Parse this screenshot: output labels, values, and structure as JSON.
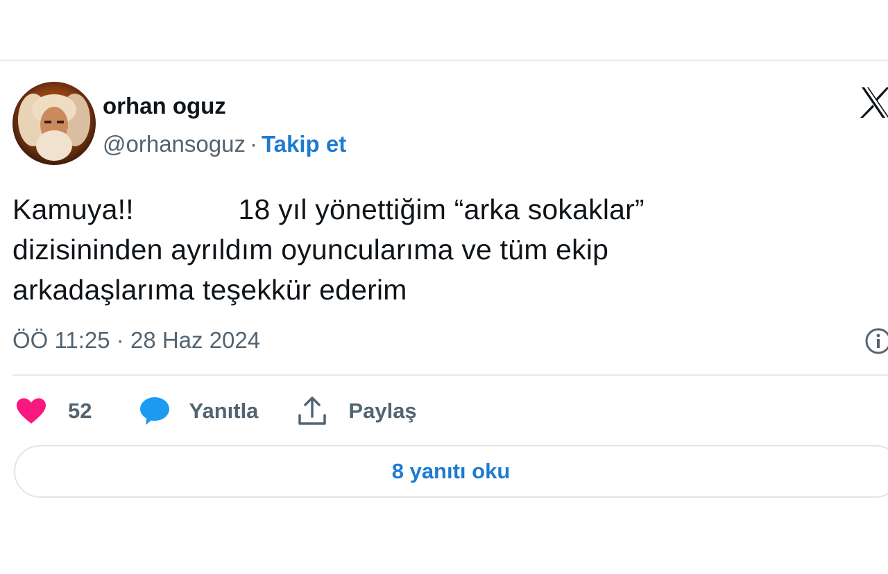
{
  "author": {
    "name": "orhan oguz",
    "handle": "@orhansoguz",
    "separator": "·",
    "follow_label": "Takip et"
  },
  "tweet": {
    "text": "Kamuya!!             18 yıl yönettiğim “arka sokaklar”\ndizisininden ayrıldım oyuncularıma ve tüm ekip\narkadaşlarıma teşekkür ederim",
    "timestamp": "ÖÖ 11:25 · 28 Haz 2024"
  },
  "actions": {
    "like_count": "52",
    "reply_label": "Yanıtla",
    "share_label": "Paylaş"
  },
  "footer": {
    "read_replies_label": "8 yanıtı oku"
  },
  "colors": {
    "like": "#f91880",
    "reply": "#1d9bf0",
    "link": "#1d7bd0",
    "muted": "#536471",
    "text": "#0f1419",
    "border": "#e6e9eb"
  },
  "icons": {
    "platform": "x-logo-icon",
    "info": "info-icon",
    "like": "heart-icon",
    "reply": "speech-bubble-icon",
    "share": "share-upload-icon"
  }
}
